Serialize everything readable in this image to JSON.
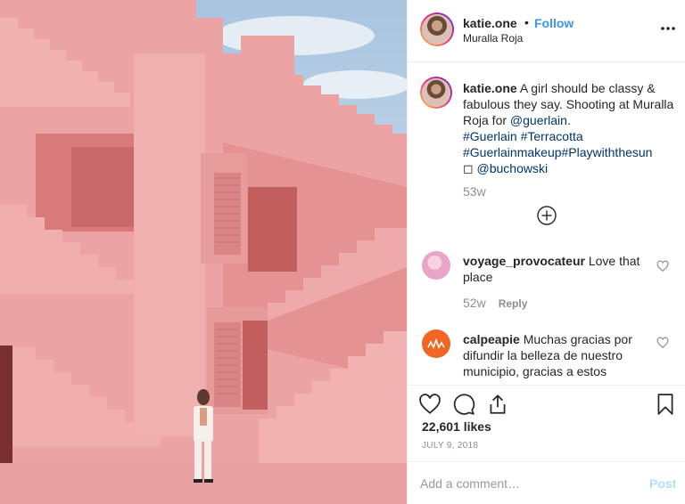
{
  "post": {
    "author": "katie.one",
    "location": "Muralla Roja",
    "follow_label": "Follow",
    "dot": "•"
  },
  "caption": {
    "username": "katie.one",
    "text_1": " A girl should be classy & fabulous they say. Shooting at Muralla Roja for ",
    "mention_1": "@guerlain",
    "text_2": ". ",
    "tag_1": "#Guerlain",
    "tag_2": "#Terracotta",
    "tag_3": "#Guerlainmakeup",
    "tag_4": "#Playwiththesun",
    "camera_glyph": "◻",
    "mention_2": "@buchowski",
    "age": "53w"
  },
  "comments": [
    {
      "username": "voyage_provocateur",
      "text": " Love that place",
      "age": "52w",
      "reply_label": "Reply",
      "avatar_color": "#e8a5c8"
    },
    {
      "username": "calpeapie",
      "text": " Muchas gracias por difundir la belleza de nuestro municipio, gracias a estos",
      "avatar_color": "#f26522"
    }
  ],
  "stats": {
    "likes": "22,601 likes",
    "date": "JULY 9, 2018"
  },
  "compose": {
    "placeholder": "Add a comment…",
    "post_label": "Post"
  },
  "icons": {
    "more": "more-horizontal-icon",
    "load_more": "plus-circle-icon",
    "like": "heart-icon",
    "comment": "comment-bubble-icon",
    "share": "share-icon",
    "save": "bookmark-icon"
  },
  "colors": {
    "link": "#003569",
    "follow": "#3897f0",
    "muted": "#8e8e8e",
    "post_disabled": "#b2dffc",
    "wall": "#eea5a5"
  }
}
